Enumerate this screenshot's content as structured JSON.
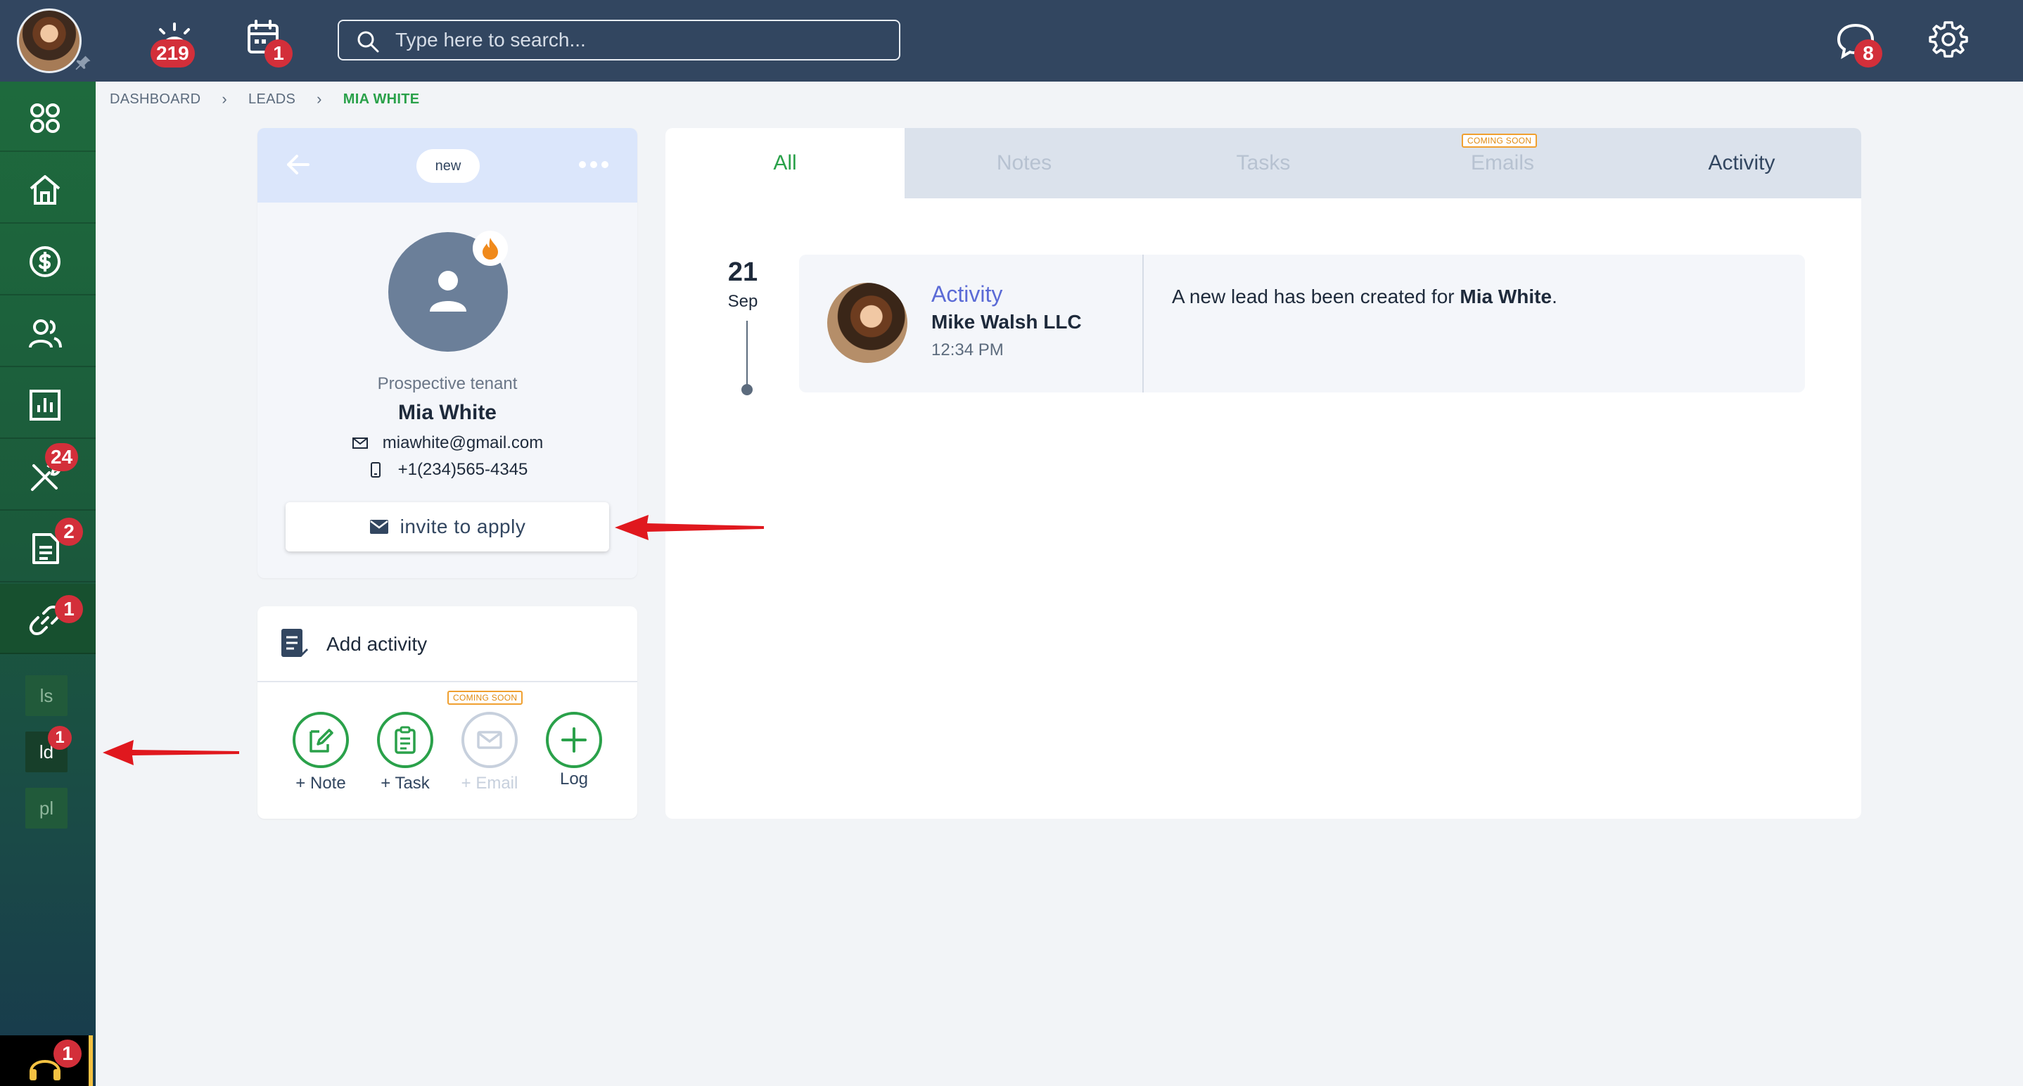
{
  "topbar": {
    "notifications_badge": "219",
    "calendar_badge": "1",
    "search_placeholder": "Type here to search...",
    "messages_badge": "8"
  },
  "sidebar": {
    "items": [
      {
        "name": "apps",
        "badge": ""
      },
      {
        "name": "home",
        "badge": ""
      },
      {
        "name": "payments",
        "badge": ""
      },
      {
        "name": "people",
        "badge": ""
      },
      {
        "name": "reports",
        "badge": ""
      },
      {
        "name": "maintenance",
        "badge": "24"
      },
      {
        "name": "documents",
        "badge": "2"
      },
      {
        "name": "links",
        "badge": "1"
      }
    ],
    "sub_items": [
      {
        "label": "ls",
        "badge": ""
      },
      {
        "label": "ld",
        "badge": "1"
      },
      {
        "label": "pl",
        "badge": ""
      }
    ],
    "support_badge": "1"
  },
  "breadcrumb": {
    "items": [
      "DASHBOARD",
      "LEADS"
    ],
    "current": "MIA WHITE"
  },
  "lead": {
    "status": "new",
    "role": "Prospective tenant",
    "name": "Mia White",
    "email": "miawhite@gmail.com",
    "phone": "+1(234)565-4345",
    "invite_label": "invite to apply"
  },
  "add_activity": {
    "title": "Add activity",
    "coming_soon": "COMING SOON",
    "actions": [
      {
        "label": "+ Note",
        "enabled": true
      },
      {
        "label": "+ Task",
        "enabled": true
      },
      {
        "label": "+ Email",
        "enabled": false
      },
      {
        "label": "Log",
        "enabled": true
      }
    ]
  },
  "timeline": {
    "tabs": [
      {
        "label": "All",
        "state": "active"
      },
      {
        "label": "Notes",
        "state": "disabled"
      },
      {
        "label": "Tasks",
        "state": "disabled"
      },
      {
        "label": "Emails",
        "state": "disabled"
      },
      {
        "label": "Activity",
        "state": "enabled"
      }
    ],
    "emails_tag": "COMING SOON",
    "entry": {
      "day": "21",
      "month": "Sep",
      "type": "Activity",
      "company": "Mike Walsh LLC",
      "time": "12:34 PM",
      "text_prefix": "A new lead has been created for ",
      "text_name": "Mia White",
      "text_suffix": "."
    }
  },
  "colors": {
    "topbar": "#324660",
    "accent_green": "#2aa14a",
    "badge_red": "#d32f3a",
    "activity_blue": "#5b6bd6",
    "annotation_red": "#e0181e"
  }
}
